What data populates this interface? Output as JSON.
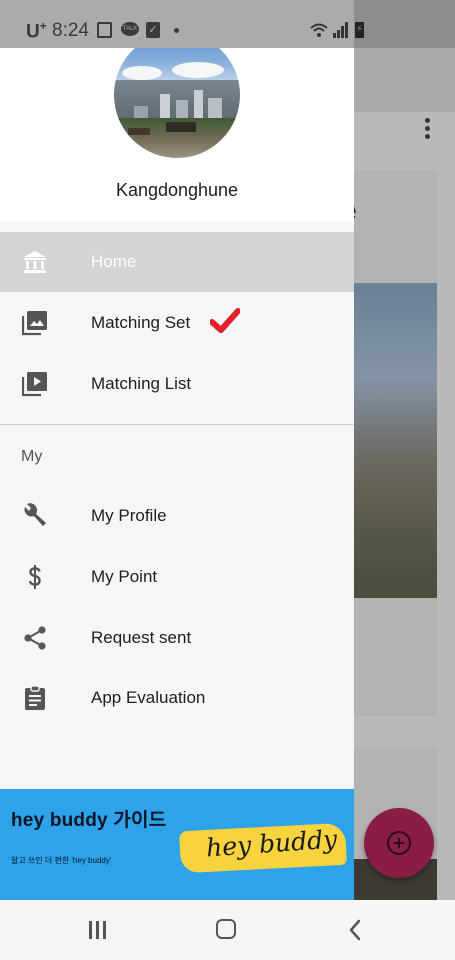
{
  "status_bar": {
    "carrier": "U",
    "carrier_sup": "+",
    "time": "8:24",
    "icons": [
      "gallery-icon",
      "talk-icon",
      "check-icon",
      "dot-icon",
      "wifi-icon",
      "signal-icon",
      "battery-charging-icon"
    ]
  },
  "drawer": {
    "user_name": "Kangdonghune",
    "menu": [
      {
        "label": "Home",
        "icon": "bank-icon",
        "active": true
      },
      {
        "label": "Matching Set",
        "icon": "photo-library-icon",
        "active": false,
        "badge": "checkmark-icon"
      },
      {
        "label": "Matching List",
        "icon": "video-library-icon",
        "active": false
      }
    ],
    "section_title": "My",
    "my_menu": [
      {
        "label": "My Profile",
        "icon": "wrench-icon"
      },
      {
        "label": "My Point",
        "icon": "dollar-icon"
      },
      {
        "label": "Request sent",
        "icon": "share-icon"
      },
      {
        "label": "App Evaluation",
        "icon": "clipboard-icon"
      }
    ],
    "banner": {
      "title": "hey buddy 가이드",
      "subtitle": "알고 쓰인 더 편한 'hey buddy'",
      "script": "hey buddy",
      "bg_color": "#2ea3ea",
      "brush_color": "#f7d43d"
    }
  },
  "background": {
    "card_title_fragment": "e"
  },
  "colors": {
    "active_item_bg": "#d4d4d4",
    "check_red": "#e3202b",
    "fab": "#8a1d45"
  },
  "nav_bar": {
    "buttons": [
      "recent-apps-button",
      "home-button",
      "back-button"
    ]
  }
}
